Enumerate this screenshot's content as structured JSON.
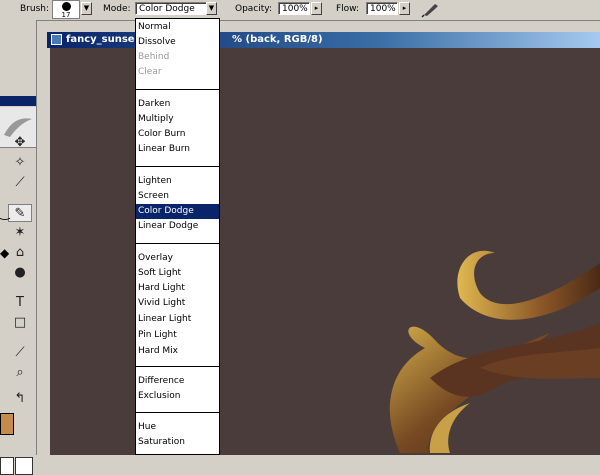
{
  "options_bar": {
    "brush_label": "Brush:",
    "brush_size": "17",
    "mode_label": "Mode:",
    "mode_value": "Color Dodge",
    "opacity_label": "Opacity:",
    "opacity_value": "100%",
    "flow_label": "Flow:",
    "flow_value": "100%"
  },
  "document": {
    "title_left": "fancy_sunse",
    "title_right": "% (back, RGB/8)"
  },
  "mode_list": {
    "items": [
      "Normal",
      "Dissolve",
      "Behind",
      "Clear",
      "Darken",
      "Multiply",
      "Color Burn",
      "Linear Burn",
      "Lighten",
      "Screen",
      "Color Dodge",
      "Linear Dodge",
      "Overlay",
      "Soft Light",
      "Hard Light",
      "Vivid Light",
      "Linear Light",
      "Pin Light",
      "Hard Mix",
      "Difference",
      "Exclusion",
      "Hue",
      "Saturation"
    ],
    "selected": "Color Dodge",
    "disabled": [
      "Behind",
      "Clear"
    ]
  },
  "colors": {
    "canvas": "#4a3c3a",
    "selection": "#0a246a",
    "foreground": "#c48a4e"
  }
}
